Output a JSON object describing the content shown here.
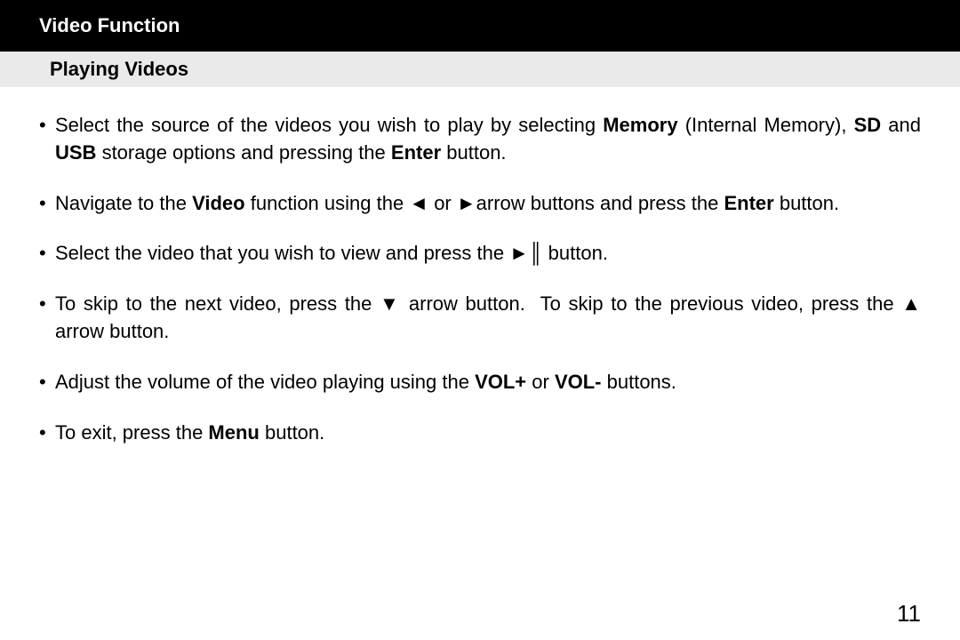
{
  "header": {
    "title": "Video Function",
    "subheading": "Playing Videos"
  },
  "bullets": [
    {
      "html": "Select the source of the videos you wish to play by selecting <b>Memory</b> (Internal Memory), <b>SD</b> and <b>USB</b> storage options and pressing the <b>Enter</b> button."
    },
    {
      "html": "Navigate to the <b>Video</b> function using the ◄ or ►arrow buttons and press the <b>Enter</b> button."
    },
    {
      "html": "Select the video that you wish to view and press the ►║ button."
    },
    {
      "html": "To skip to the next video, press the ▼ arrow button.&nbsp; To skip to the previous video, press the ▲ arrow button."
    },
    {
      "html": "Adjust the volume of the video playing using the <b>VOL+</b> or <b>VOL-</b> buttons."
    },
    {
      "html": "To exit, press the <b>Menu</b> button."
    }
  ],
  "page_number": "11"
}
